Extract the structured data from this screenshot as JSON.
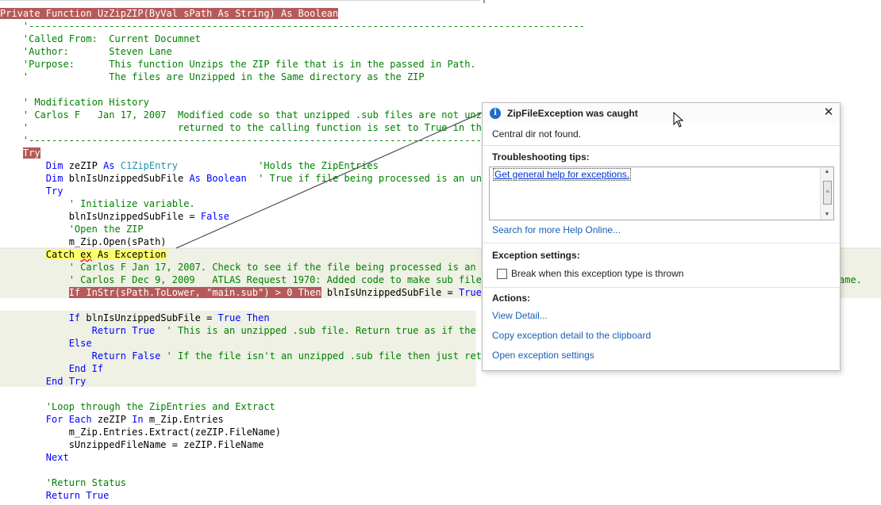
{
  "editor": {
    "lines": [
      {
        "tokens": [
          {
            "t": "Private Function UzZipZIP(ByVal sPath As String) As Boolean",
            "c": "ol"
          }
        ]
      },
      {
        "tokens": [
          {
            "t": "    '-------------------------------------------------------------------------------------------------",
            "c": "cm"
          }
        ]
      },
      {
        "tokens": [
          {
            "t": "    'Called From:  Current Documnet",
            "c": "cm"
          }
        ]
      },
      {
        "tokens": [
          {
            "t": "    'Author:       Steven Lane",
            "c": "cm"
          }
        ]
      },
      {
        "tokens": [
          {
            "t": "    'Purpose:      This function Unzips the ZIP file that is in the passed in Path.",
            "c": "cm"
          }
        ]
      },
      {
        "tokens": [
          {
            "t": "    '              The files are Unzipped in the Same directory as the ZIP",
            "c": "cm"
          }
        ]
      },
      {
        "tokens": []
      },
      {
        "tokens": [
          {
            "t": "    ' Modification History",
            "c": "cm"
          }
        ]
      },
      {
        "tokens": [
          {
            "t": "    ' Carlos F   Jan 17, 2007  Modified code so that unzipped .sub files are not unzi",
            "c": "cm"
          }
        ]
      },
      {
        "tokens": [
          {
            "t": "    '                          returned to the calling function is set to True in th",
            "c": "cm"
          }
        ]
      },
      {
        "tokens": [
          {
            "t": "    '---------------------------------------------------------------------------------",
            "c": "cm"
          }
        ]
      },
      {
        "tokens": [
          {
            "t": "    "
          },
          {
            "t": "Try",
            "c": "ol"
          }
        ]
      },
      {
        "tokens": [
          {
            "t": "        "
          },
          {
            "t": "Dim",
            "c": "kw"
          },
          {
            "t": " zeZIP "
          },
          {
            "t": "As",
            "c": "kw"
          },
          {
            "t": " "
          },
          {
            "t": "C1ZipEntry",
            "c": "ty"
          },
          {
            "t": "              "
          },
          {
            "t": "'Holds the ZipEntries",
            "c": "cm"
          }
        ]
      },
      {
        "tokens": [
          {
            "t": "        "
          },
          {
            "t": "Dim",
            "c": "kw"
          },
          {
            "t": " blnIsUnzippedSubFile "
          },
          {
            "t": "As",
            "c": "kw"
          },
          {
            "t": " "
          },
          {
            "t": "Boolean",
            "c": "kw"
          },
          {
            "t": "  "
          },
          {
            "t": "' True if file being processed is an un",
            "c": "cm"
          }
        ]
      },
      {
        "tokens": [
          {
            "t": "        "
          },
          {
            "t": "Try",
            "c": "kw"
          }
        ]
      },
      {
        "tokens": [
          {
            "t": "            "
          },
          {
            "t": "' Initialize variable.",
            "c": "cm"
          }
        ]
      },
      {
        "tokens": [
          {
            "t": "            blnIsUnzippedSubFile = "
          },
          {
            "t": "False",
            "c": "kw"
          }
        ]
      },
      {
        "tokens": [
          {
            "t": "            "
          },
          {
            "t": "'Open the ZIP",
            "c": "cm"
          }
        ]
      },
      {
        "tokens": [
          {
            "t": "            m_Zip.Open(sPath)"
          }
        ]
      },
      {
        "tokens": [
          {
            "t": "        "
          },
          {
            "t": "Catch ",
            "c": "hl"
          },
          {
            "t": "ex",
            "c": "hlsq"
          },
          {
            "t": " As Exception",
            "c": "hl"
          }
        ]
      },
      {
        "tokens": [
          {
            "t": "            "
          },
          {
            "t": "' Carlos F Jan 17, 2007. Check to see if the file being processed is an",
            "c": "cm"
          }
        ]
      },
      {
        "tokens": [
          {
            "t": "            "
          },
          {
            "t": "' Carlos F Dec 9, 2009   ATLAS Request 1970: Added code to make sub file",
            "c": "cm"
          }
        ]
      },
      {
        "tokens": [
          {
            "t": "            "
          },
          {
            "t": "If InStr(sPath.ToLower, \"main.sub\") > 0 Then",
            "c": "ol"
          },
          {
            "t": " blnIsUnzippedSubFile = "
          },
          {
            "t": "True",
            "c": "kw"
          }
        ]
      },
      {
        "tokens": []
      },
      {
        "tokens": [
          {
            "t": "            "
          },
          {
            "t": "If",
            "c": "kw"
          },
          {
            "t": " blnIsUnzippedSubFile = "
          },
          {
            "t": "True",
            "c": "kw"
          },
          {
            "t": " "
          },
          {
            "t": "Then",
            "c": "kw"
          }
        ]
      },
      {
        "tokens": [
          {
            "t": "                "
          },
          {
            "t": "Return",
            "c": "kw"
          },
          {
            "t": " "
          },
          {
            "t": "True",
            "c": "kw"
          },
          {
            "t": "  "
          },
          {
            "t": "' This is an unzipped .sub file. Return true as if the",
            "c": "cm"
          }
        ]
      },
      {
        "tokens": [
          {
            "t": "            "
          },
          {
            "t": "Else",
            "c": "kw"
          }
        ]
      },
      {
        "tokens": [
          {
            "t": "                "
          },
          {
            "t": "Return",
            "c": "kw"
          },
          {
            "t": " "
          },
          {
            "t": "False",
            "c": "kw"
          },
          {
            "t": " "
          },
          {
            "t": "' If the file isn't an unzipped .sub file then just ret",
            "c": "cm"
          }
        ]
      },
      {
        "tokens": [
          {
            "t": "            "
          },
          {
            "t": "End If",
            "c": "kw"
          }
        ]
      },
      {
        "tokens": [
          {
            "t": "        "
          },
          {
            "t": "End Try",
            "c": "kw"
          }
        ]
      },
      {
        "tokens": []
      },
      {
        "tokens": [
          {
            "t": "        "
          },
          {
            "t": "'Loop through the ZipEntries and Extract",
            "c": "cm"
          }
        ]
      },
      {
        "tokens": [
          {
            "t": "        "
          },
          {
            "t": "For Each",
            "c": "kw"
          },
          {
            "t": " zeZIP "
          },
          {
            "t": "In",
            "c": "kw"
          },
          {
            "t": " m_Zip.Entries"
          }
        ]
      },
      {
        "tokens": [
          {
            "t": "            m_Zip.Entries.Extract(zeZIP.FileName)"
          }
        ]
      },
      {
        "tokens": [
          {
            "t": "            sUnzippedFileName = zeZIP.FileName"
          }
        ]
      },
      {
        "tokens": [
          {
            "t": "        "
          },
          {
            "t": "Next",
            "c": "kw"
          }
        ]
      },
      {
        "tokens": []
      },
      {
        "tokens": [
          {
            "t": "        "
          },
          {
            "t": "'Return Status",
            "c": "cm"
          }
        ]
      },
      {
        "tokens": [
          {
            "t": "        "
          },
          {
            "t": "Return",
            "c": "kw"
          },
          {
            "t": " "
          },
          {
            "t": "True",
            "c": "kw"
          }
        ]
      }
    ],
    "overflow_text": "ame."
  },
  "exception_helper": {
    "title": "ZipFileException was caught",
    "message": "Central dir not found.",
    "tips_heading": "Troubleshooting tips:",
    "tips": [
      "Get general help for exceptions."
    ],
    "search_link": "Search for more Help Online...",
    "settings_heading": "Exception settings:",
    "break_checkbox_label": "Break when this exception type is thrown",
    "break_checkbox_checked": false,
    "actions_heading": "Actions:",
    "actions": [
      "View Detail...",
      "Copy exception detail to the clipboard",
      "Open exception settings"
    ]
  },
  "colors": {
    "keyword": "#0000ff",
    "comment": "#008000",
    "type": "#2b91af",
    "breakpoint_red": "#b55a5a",
    "current_statement": "#ffff66",
    "catch_block_bg": "#eef1e4",
    "link": "#1a5fb4",
    "info_icon": "#1e6ccf"
  }
}
